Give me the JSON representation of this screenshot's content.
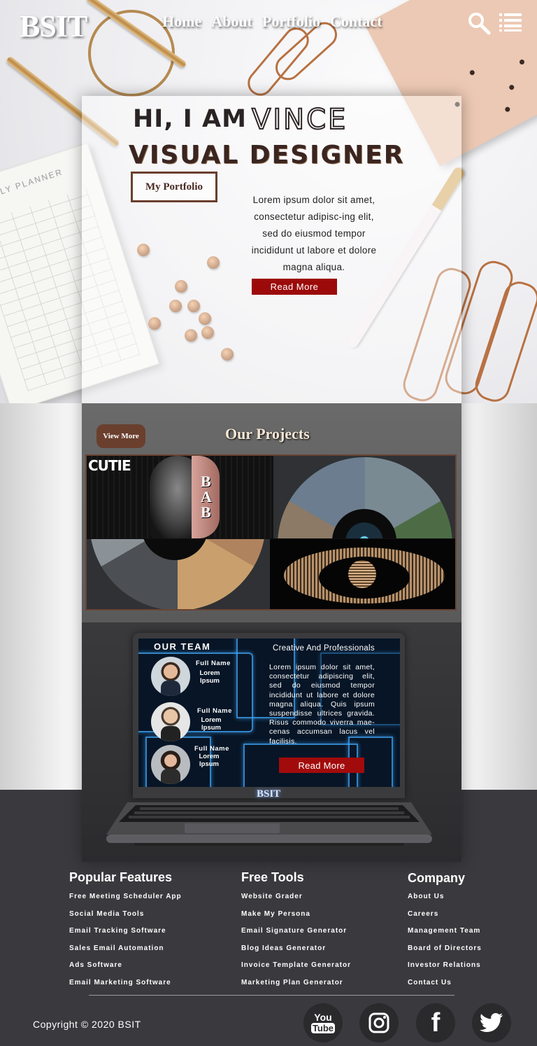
{
  "nav": {
    "logo": "BSIT",
    "links": [
      "Home",
      "About",
      "Portfolio",
      "Contact"
    ],
    "search_icon": "search-icon",
    "menu_icon": "menu-icon"
  },
  "hero": {
    "greeting": "HI, I AM",
    "name": "VINCE",
    "role": "VISUAL DESIGNER",
    "portfolio_button": "My Portfolio",
    "text": "Lorem ipsum dolor sit amet, consectetur adipisc-ing elit, sed do eiusmod tempor incididunt ut labore et dolore magna aliqua.",
    "read_more": "Read More",
    "planner_label": "YEARLY PLANNER"
  },
  "projects": {
    "view_more": "View More",
    "title": "Our Projects",
    "tile_texts": [
      "CUTIE",
      "BAB"
    ]
  },
  "team": {
    "heading": "OUR TEAM",
    "members": [
      {
        "name": "Full Name",
        "sub": "Lorem Ipsum"
      },
      {
        "name": "Full Name",
        "sub": "Lorem Ipsum"
      },
      {
        "name": "Full Name",
        "sub": "Lorem Ipsum"
      }
    ],
    "tagline": "Creative And Professionals",
    "text": "Lorem ipsum dolor sit amet, consectetur adipiscing elit, sed do eiusmod tempor incididunt ut labore et dolore magna aliqua. Quis ipsum suspendisse ultrices gravida. Risus commodo viverra mae-cenas accumsan lacus vel facilisis.",
    "read_more": "Read More",
    "laptop_logo": "BSIT"
  },
  "footer": {
    "columns": [
      {
        "title": "Popular Features",
        "items": [
          "Free Meeting Scheduler App",
          "Social Media Tools",
          "Email Tracking Software",
          "Sales Email Automation",
          "Ads Software",
          "Email Marketing Software"
        ]
      },
      {
        "title": "Free Tools",
        "items": [
          "Website Grader",
          "Make My Persona",
          "Email Signature Generator",
          "Blog Ideas Generator",
          "Invoice Template Generator",
          "Marketing Plan Generator"
        ]
      },
      {
        "title": "Company",
        "items": [
          "About Us",
          "Careers",
          "Management Team",
          "Board of Directors",
          "Investor Relations",
          "Contact Us"
        ]
      }
    ],
    "copyright": "Copyright © 2020 BSIT",
    "social": [
      {
        "icon": "youtube-icon",
        "label_top": "You",
        "label_bottom": "Tube"
      },
      {
        "icon": "instagram-icon"
      },
      {
        "icon": "facebook-icon",
        "label": "f"
      },
      {
        "icon": "twitter-icon"
      }
    ]
  },
  "colors": {
    "accent_red": "#9c0a0a",
    "brown": "#6a3f2e",
    "footer_bg": "#3a393d"
  }
}
